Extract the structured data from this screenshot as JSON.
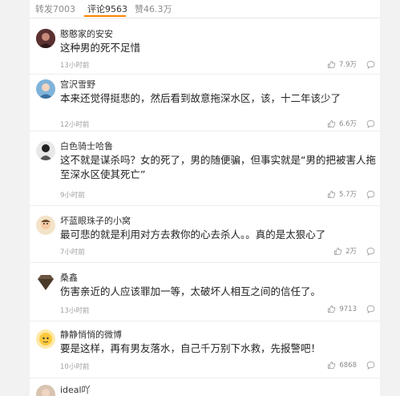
{
  "tabs": [
    {
      "label": "转发7003"
    },
    {
      "label": "评论9563"
    },
    {
      "label": "赞46.3万"
    }
  ],
  "comments": [
    {
      "user": "憨憨家的安安",
      "text": "这种男的死不足惜",
      "time": "13小时前",
      "likes": "7.9万"
    },
    {
      "user": "宫沢雪野",
      "text": "本来还觉得挺悲的，然后看到故意拖深水区，该，十二年该少了",
      "time": "12小时前",
      "likes": "6.6万"
    },
    {
      "user": "白色骑士哈鲁",
      "text": "这不就是谋杀吗？女的死了，男的随便骗，但事实就是“男的把被害人拖至深水区使其死亡”",
      "time": "9小时前",
      "likes": "5.7万"
    },
    {
      "user": "坏蓝眼珠子的小窝",
      "text": "最可悲的就是利用对方去救你的心去杀人。。真的是太狠心了",
      "time": "7小时前",
      "likes": "2万"
    },
    {
      "user": "桑鑫",
      "text": "伤害亲近的人应该罪加一等，太破坏人相互之间的信任了。",
      "time": "13小时前",
      "likes": "9713"
    },
    {
      "user": "静静悄悄的微博",
      "text": "要是这样，再有男友落水，自己千万别下水救，先报警吧！",
      "time": "10小时前",
      "likes": "6868"
    },
    {
      "user": "ideal吖",
      "text": "",
      "time": "",
      "likes": ""
    }
  ],
  "icons": {
    "like": "thumbs-up-icon",
    "reply": "comment-bubble-icon"
  },
  "colors": {
    "accent_tab_underline": "#ff8200",
    "username": "#333333",
    "timestamp": "#a0a0a0"
  }
}
